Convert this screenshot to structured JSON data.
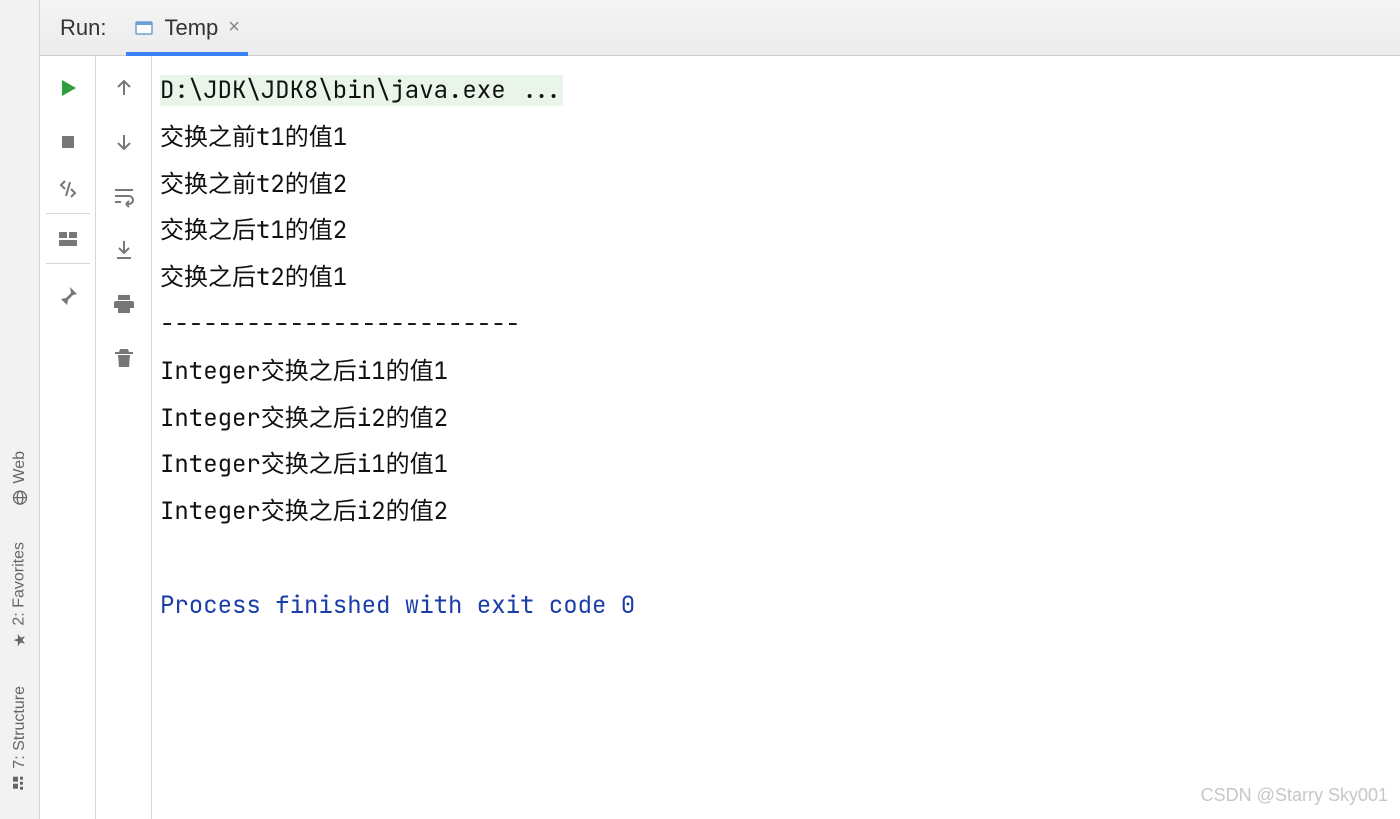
{
  "tabbar": {
    "run_label": "Run:",
    "tab_name": "Temp"
  },
  "left_rail": {
    "structure": "7: Structure",
    "favorites": "2: Favorites",
    "web": "Web"
  },
  "console": {
    "cmd": "D:\\JDK\\JDK8\\bin\\java.exe ...",
    "lines": [
      "交换之前t1的值1",
      "交换之前t2的值2",
      "交换之后t1的值2",
      "交换之后t2的值1",
      "-------------------------",
      "Integer交换之后i1的值1",
      "Integer交换之后i2的值2",
      "Integer交换之后i1的值1",
      "Integer交换之后i2的值2"
    ],
    "exit": "Process finished with exit code 0"
  },
  "watermark": "CSDN @Starry Sky001"
}
